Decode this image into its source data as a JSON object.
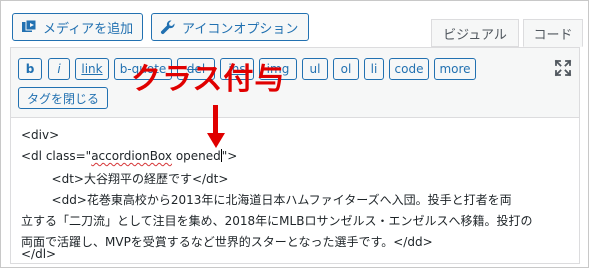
{
  "header": {
    "add_media_label": "メディアを追加",
    "icon_option_label": "アイコンオプション"
  },
  "tabs": {
    "visual_label": "ビジュアル",
    "code_label": "コード"
  },
  "quicktags": {
    "row1": [
      "b",
      "i",
      "link",
      "b-quote",
      "del",
      "ins",
      "img",
      "ul",
      "ol",
      "li",
      "code",
      "more"
    ],
    "close_tags_label": "タグを閉じる"
  },
  "annotation": {
    "text": "クラス付与",
    "color": "#e00000"
  },
  "editor": {
    "lines": {
      "l1": "<div>",
      "l2_pre": "<dl class=\"",
      "l2_squiggle": "accordionBox",
      "l2_mid": " opened",
      "l2_post": "\">",
      "l3": "        <dt>大谷翔平の経歴です</dt>",
      "l4": "        <dd>花巻東高校から2013年に北海道日本ハムファイターズへ入団。投手と打者を両",
      "l5": "立する「二刀流」として注目を集め、2018年にMLBロサンゼルス・エンゼルスへ移籍。投打の",
      "l6": "両面で活躍し、MVPを受賞するなど世界的スターとなった選手です。</dd>",
      "l7": "</dl>"
    }
  },
  "colors": {
    "accent": "#2271b1",
    "annotation_red": "#e00000"
  },
  "icons": {
    "media": "media-icon",
    "icon_option": "wrench-icon",
    "fullscreen": "fullscreen-icon"
  }
}
